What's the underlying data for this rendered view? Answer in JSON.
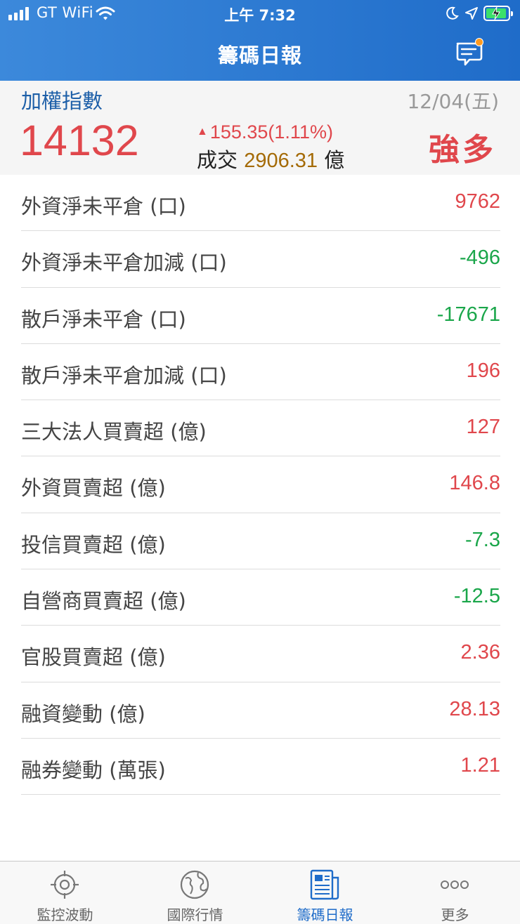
{
  "status_bar": {
    "carrier": "GT WiFi",
    "time": "上午 7:32"
  },
  "nav": {
    "title": "籌碼日報"
  },
  "index": {
    "name": "加權指數",
    "date": "12/04(五)",
    "value": "14132",
    "change": "155.35(1.11%)",
    "volume_label": "成交",
    "volume": "2906.31",
    "volume_unit": "億",
    "trend": "強多"
  },
  "rows": [
    {
      "label": "外資淨未平倉 (口)",
      "value": "9762",
      "dir": "up"
    },
    {
      "label": "外資淨未平倉加減 (口)",
      "value": "-496",
      "dir": "down"
    },
    {
      "label": "散戶淨未平倉 (口)",
      "value": "-17671",
      "dir": "down"
    },
    {
      "label": "散戶淨未平倉加減 (口)",
      "value": "196",
      "dir": "up"
    },
    {
      "label": "三大法人買賣超 (億)",
      "value": "127",
      "dir": "up"
    },
    {
      "label": "外資買賣超 (億)",
      "value": "146.8",
      "dir": "up"
    },
    {
      "label": "投信買賣超 (億)",
      "value": "-7.3",
      "dir": "down"
    },
    {
      "label": "自營商買賣超 (億)",
      "value": "-12.5",
      "dir": "down"
    },
    {
      "label": "官股買賣超 (億)",
      "value": "2.36",
      "dir": "up"
    },
    {
      "label": "融資變動 (億)",
      "value": "28.13",
      "dir": "up"
    },
    {
      "label": "融券變動 (萬張)",
      "value": "1.21",
      "dir": "up"
    }
  ],
  "colors": {
    "up": "#e0474c",
    "down": "#1aa64a",
    "accent": "#1f6cc9",
    "volume": "#a46a06"
  },
  "tabs": [
    {
      "label": "監控波動",
      "icon": "target-icon",
      "active": false
    },
    {
      "label": "國際行情",
      "icon": "globe-icon",
      "active": false
    },
    {
      "label": "籌碼日報",
      "icon": "newspaper-icon",
      "active": true
    },
    {
      "label": "更多",
      "icon": "more-icon",
      "active": false
    }
  ]
}
